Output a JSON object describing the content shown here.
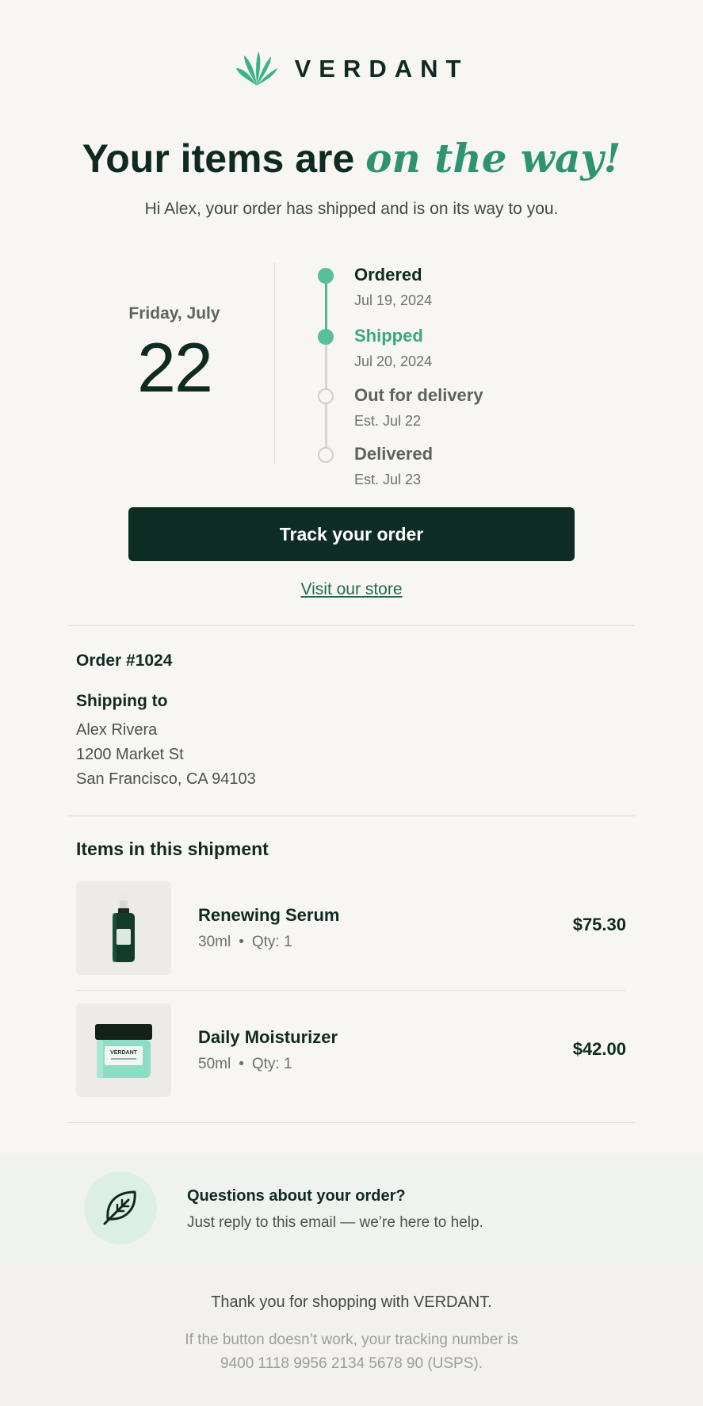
{
  "brand": {
    "name": "VERDANT",
    "logo_icon": "fan-leaf-icon",
    "accent_color": "#3aa879",
    "dark_color": "#0d2c23"
  },
  "hero": {
    "headline_prefix": "Your items are ",
    "headline_accent": "on the way",
    "headline_suffix": "!",
    "intro": "Hi Alex, your order has shipped and is on its way to you."
  },
  "delivery_date": {
    "label": "Friday, July",
    "day": "22"
  },
  "timeline": [
    {
      "title": "Ordered",
      "date": "Jul 19, 2024",
      "state": "done"
    },
    {
      "title": "Shipped",
      "date": "Jul 20, 2024",
      "state": "active"
    },
    {
      "title": "Out for delivery",
      "date": "Est. Jul 22",
      "state": "pending"
    },
    {
      "title": "Delivered",
      "date": "Est. Jul 23",
      "state": "pending"
    }
  ],
  "actions": {
    "track_label": "Track your order",
    "store_label": "Visit our store"
  },
  "order": {
    "number": "Order #1024",
    "shipping_label": "Shipping to",
    "address": [
      "Alex Rivera",
      "1200 Market St",
      "San Francisco, CA 94103"
    ]
  },
  "shipment": {
    "title": "Items in this shipment",
    "items": [
      {
        "name": "Renewing Serum",
        "size": "30ml",
        "qty": "Qty: 1",
        "price": "$75.30",
        "image": "serum-bottle"
      },
      {
        "name": "Daily Moisturizer",
        "size": "50ml",
        "qty": "Qty: 1",
        "price": "$42.00",
        "image": "moisturizer-jar"
      }
    ],
    "separator": "•",
    "jar_label": "VERDANT"
  },
  "help": {
    "icon": "leaf-icon",
    "title": "Questions about your order?",
    "text": "Just reply to this email — we’re here to help."
  },
  "footer": {
    "thanks": "Thank you for shopping with VERDANT.",
    "fine_line1": "If the button doesn’t work, your tracking number is",
    "fine_line2": "9400 1118 9956 2134 5678 90 (USPS)."
  }
}
